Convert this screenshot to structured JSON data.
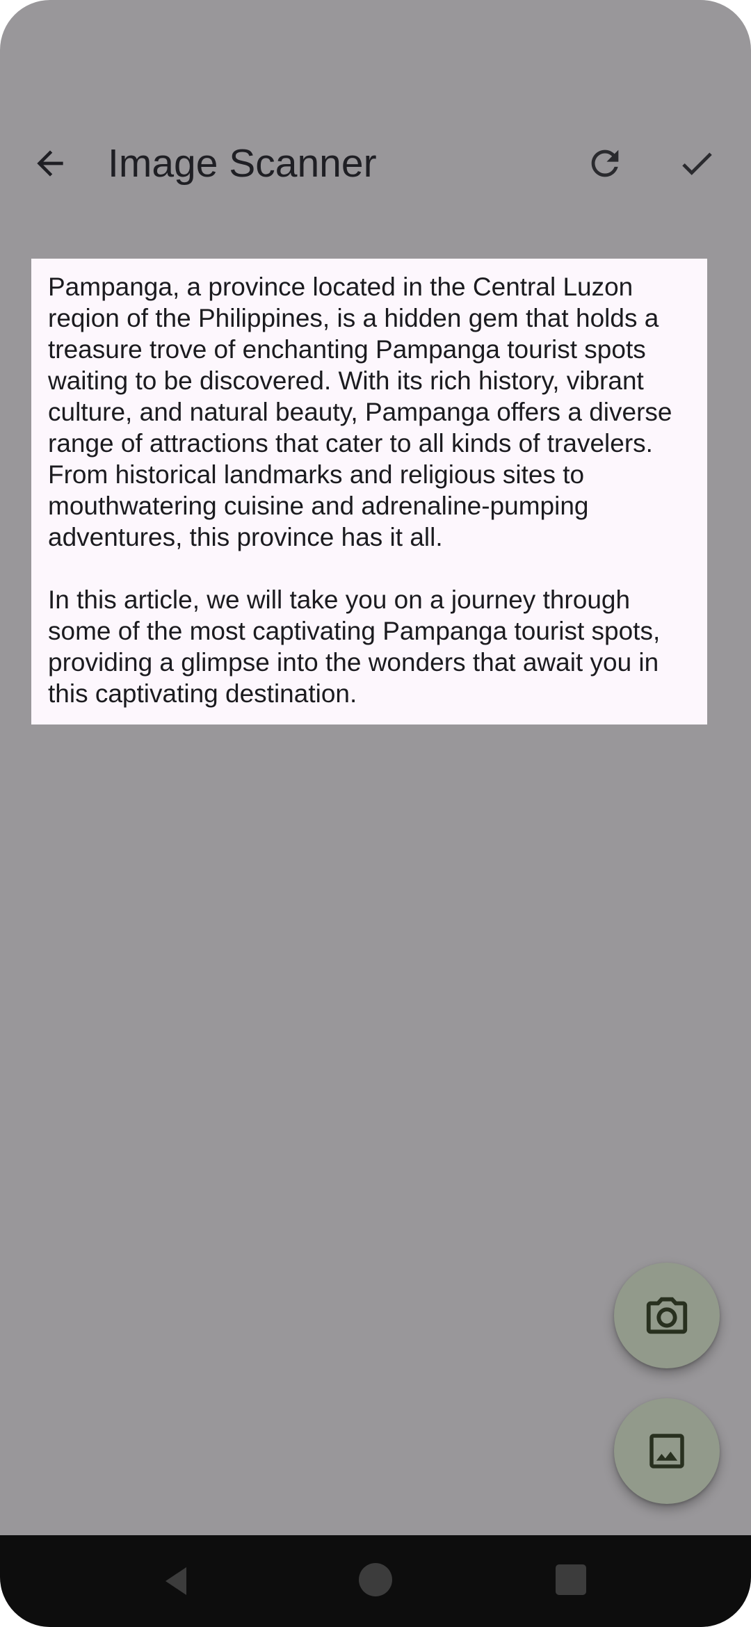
{
  "app_bar": {
    "title": "Image Scanner",
    "back_icon": "arrow-back-icon",
    "refresh_icon": "refresh-icon",
    "confirm_icon": "check-icon"
  },
  "scanned_text": {
    "paragraphs": [
      "Pampanga, a province located in the Central Luzon reqion of the Philippines, is a hidden gem that holds a treasure trove of enchanting Pampanga tourist spots waiting to be discovered. With its rich history, vibrant culture, and natural beauty, Pampanga offers a diverse range of attractions that cater to all kinds of travelers. From historical landmarks and religious sites to mouthwatering cuisine and adrenaline-pumping adventures, this province has it all.",
      "In this article, we will take you on a journey through some of the most captivating Pampanga tourist spots, providing a glimpse into the wonders that await you in this captivating destination."
    ]
  },
  "fabs": {
    "camera_icon": "camera-icon",
    "gallery_icon": "image-icon"
  },
  "nav": {
    "back_icon": "nav-back-icon",
    "home_icon": "nav-home-icon",
    "recents_icon": "nav-recents-icon"
  },
  "colors": {
    "scrim": "#99979a",
    "card": "#fdf7fd",
    "fab": "#929a8b",
    "icon": "#1f1f24"
  }
}
